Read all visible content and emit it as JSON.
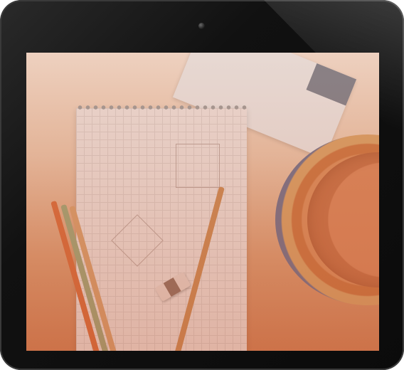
{
  "device": {
    "type": "tablet",
    "orientation": "portrait"
  },
  "screen": {
    "image": "desk-with-notebook-pencils",
    "colors": {
      "tint": "#d9845a",
      "bezel": "#111111"
    }
  },
  "icons": [
    "camera-icon"
  ]
}
